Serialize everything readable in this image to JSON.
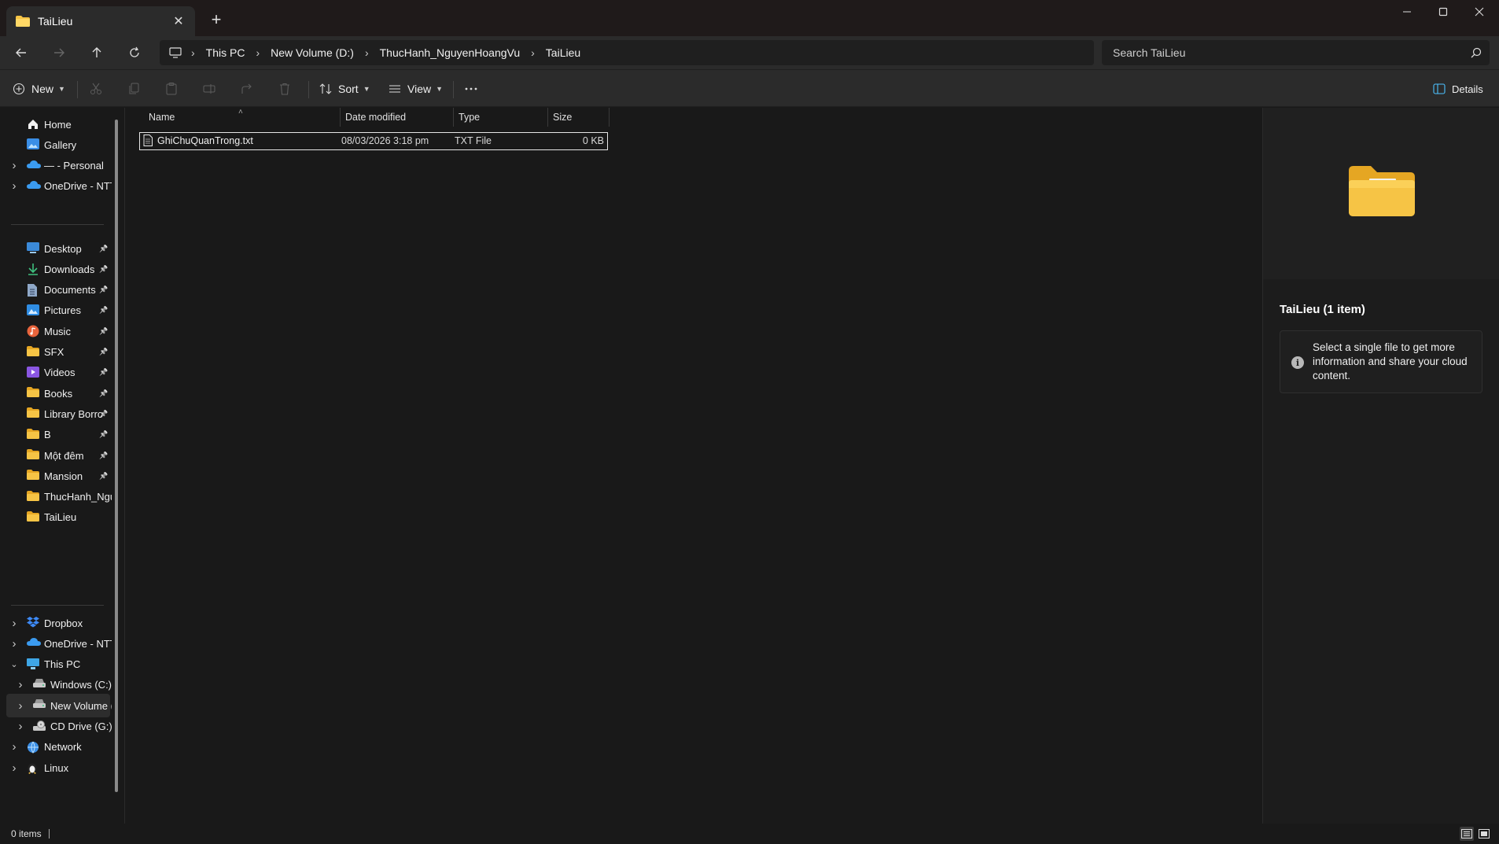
{
  "window": {
    "tab_title": "TaiLieu",
    "new_tab": "+"
  },
  "breadcrumb": [
    "This PC",
    "New Volume (D:)",
    "ThucHanh_NguyenHoangVu",
    "TaiLieu"
  ],
  "search": {
    "placeholder": "Search TaiLieu"
  },
  "commandbar": {
    "new_label": "New",
    "sort_label": "Sort",
    "view_label": "View",
    "details_label": "Details"
  },
  "sidebar": {
    "top": [
      {
        "label": "Home",
        "icon": "home-icon"
      },
      {
        "label": "Gallery",
        "icon": "gallery-icon"
      },
      {
        "label": "— - Personal",
        "icon": "onedrive-icon"
      },
      {
        "label": "OneDrive - NTT",
        "icon": "onedrive-icon"
      }
    ],
    "pinned": [
      {
        "label": "Desktop",
        "icon": "desktop-icon"
      },
      {
        "label": "Downloads",
        "icon": "downloads-icon"
      },
      {
        "label": "Documents",
        "icon": "documents-icon"
      },
      {
        "label": "Pictures",
        "icon": "pictures-icon"
      },
      {
        "label": "Music",
        "icon": "music-icon"
      },
      {
        "label": "SFX",
        "icon": "folder-icon"
      },
      {
        "label": "Videos",
        "icon": "videos-icon"
      },
      {
        "label": "Books",
        "icon": "folder-icon"
      },
      {
        "label": "Library Borro",
        "icon": "folder-icon"
      },
      {
        "label": "B",
        "icon": "folder-icon"
      },
      {
        "label": "Một đêm",
        "icon": "folder-icon"
      },
      {
        "label": "Mansion",
        "icon": "folder-icon"
      },
      {
        "label": "ThucHanh_Ngu",
        "icon": "folder-icon"
      },
      {
        "label": "TaiLieu",
        "icon": "folder-icon"
      }
    ],
    "bottom": [
      {
        "label": "Dropbox",
        "icon": "dropbox-icon"
      },
      {
        "label": "OneDrive - NTT",
        "icon": "onedrive-icon"
      },
      {
        "label": "This PC",
        "icon": "pc-icon"
      },
      {
        "label": "Windows (C:)",
        "icon": "drive-icon"
      },
      {
        "label": "New Volume (I",
        "icon": "drive-icon"
      },
      {
        "label": "CD Drive (G:)",
        "icon": "cd-drive-icon"
      },
      {
        "label": "Network",
        "icon": "network-icon"
      },
      {
        "label": "Linux",
        "icon": "linux-icon"
      }
    ]
  },
  "columns": {
    "name": "Name",
    "date": "Date modified",
    "type": "Type",
    "size": "Size"
  },
  "files": [
    {
      "name": "GhiChuQuanTrong.txt",
      "date": "08/03/2026 3:18 pm",
      "type": "TXT File",
      "size": "0 KB"
    }
  ],
  "details_pane": {
    "title": "TaiLieu (1 item)",
    "info": "Select a single file to get more information and share your cloud content."
  },
  "status": {
    "count": "0 items"
  },
  "colors": {
    "folder": "#f6c445",
    "accent": "#4cc2ff",
    "background": "#191919"
  }
}
